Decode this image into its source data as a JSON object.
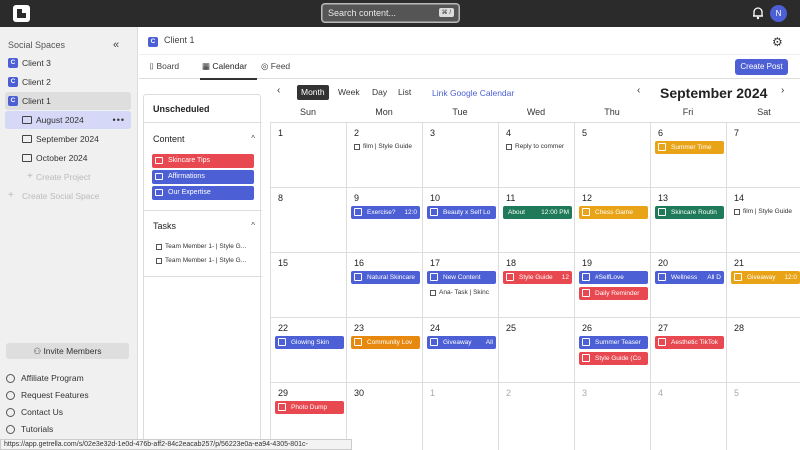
{
  "topbar": {
    "search_placeholder": "Search content...",
    "search_kbd": "⌘ /",
    "avatar": "N"
  },
  "sidebar": {
    "title": "Social Spaces",
    "clients": [
      {
        "badge": "C",
        "label": "Client 3"
      },
      {
        "badge": "C",
        "label": "Client 2"
      },
      {
        "badge": "C",
        "label": "Client 1"
      }
    ],
    "projects": [
      {
        "label": "August 2024"
      },
      {
        "label": "September 2024"
      },
      {
        "label": "October 2024"
      }
    ],
    "create_project": "Create Project",
    "create_space": "Create Social Space",
    "invite": "Invite Members",
    "footer": [
      "Affiliate Program",
      "Request Features",
      "Contact Us",
      "Tutorials"
    ],
    "status_url": "https://app.getrella.com/s/02e3e32d-1e0d-476b-aff2-84c2eacab257/p/56223e0a-ea94-4305-801c-f126bf840a70"
  },
  "main": {
    "breadcrumb_badge": "C",
    "breadcrumb": "Client 1",
    "tabs": [
      "Board",
      "Calendar",
      "Feed"
    ],
    "create_post": "Create Post"
  },
  "unscheduled": {
    "title": "Unscheduled",
    "content_title": "Content",
    "content_items": [
      {
        "label": "Skincare Tips",
        "color": "#e8484f"
      },
      {
        "label": "Affirmations",
        "color": "#4c5fd5"
      },
      {
        "label": "Our Expertise",
        "color": "#4c5fd5"
      }
    ],
    "tasks_title": "Tasks",
    "tasks": [
      "Team Member 1- | Style G...",
      "Team Member 1- | Style G..."
    ]
  },
  "calendar": {
    "views": [
      "Month",
      "Week",
      "Day",
      "List"
    ],
    "link_google": "Link Google Calendar",
    "month_title": "September 2024",
    "days": [
      "Sun",
      "Mon",
      "Tue",
      "Wed",
      "Thu",
      "Fri",
      "Sat"
    ],
    "weeks": [
      [
        {
          "d": "1"
        },
        {
          "d": "2",
          "items": [
            {
              "k": "check",
              "t": "film | Style Guide"
            }
          ]
        },
        {
          "d": "3"
        },
        {
          "d": "4",
          "items": [
            {
              "k": "check",
              "t": "Reply to commer"
            }
          ]
        },
        {
          "d": "5"
        },
        {
          "d": "6",
          "items": [
            {
              "k": "ev",
              "t": "Summer Time",
              "c": "#e8a317"
            }
          ]
        },
        {
          "d": "7"
        }
      ],
      [
        {
          "d": "8"
        },
        {
          "d": "9",
          "items": [
            {
              "k": "ev",
              "t": "Exercise?",
              "time": "12:0",
              "c": "#4c5fd5"
            }
          ]
        },
        {
          "d": "10",
          "items": [
            {
              "k": "ev",
              "t": "Beauty x Self Lo",
              "c": "#4c5fd5"
            }
          ]
        },
        {
          "d": "11",
          "items": [
            {
              "k": "txt",
              "t": "About",
              "time": "12:00 PM",
              "c": "#1f7a5a"
            }
          ]
        },
        {
          "d": "12",
          "items": [
            {
              "k": "ev",
              "t": "Chess Game",
              "c": "#e8a317"
            }
          ]
        },
        {
          "d": "13",
          "items": [
            {
              "k": "ev",
              "t": "Skincare Routin",
              "c": "#1f7a5a"
            }
          ]
        },
        {
          "d": "14",
          "items": [
            {
              "k": "check",
              "t": "film | Style Guide"
            }
          ]
        }
      ],
      [
        {
          "d": "15"
        },
        {
          "d": "16",
          "items": [
            {
              "k": "ev",
              "t": "Natural Skincare",
              "c": "#4c5fd5"
            }
          ]
        },
        {
          "d": "17",
          "items": [
            {
              "k": "ev",
              "t": "New Content",
              "c": "#4c5fd5"
            },
            {
              "k": "check",
              "t": "Ana- Task | Skinc"
            }
          ]
        },
        {
          "d": "18",
          "items": [
            {
              "k": "ev",
              "t": "Style Guide",
              "time": "12",
              "c": "#e8484f"
            }
          ]
        },
        {
          "d": "19",
          "items": [
            {
              "k": "ev",
              "t": "#SelfLove",
              "c": "#4c5fd5"
            },
            {
              "k": "ev",
              "t": "Daily Reminder",
              "c": "#e8484f"
            }
          ]
        },
        {
          "d": "20",
          "items": [
            {
              "k": "ev",
              "t": "Wellness",
              "time": "All D",
              "c": "#4c5fd5"
            }
          ]
        },
        {
          "d": "21",
          "items": [
            {
              "k": "ev",
              "t": "Giveaway",
              "time": "12:0",
              "c": "#e8a317"
            }
          ]
        }
      ],
      [
        {
          "d": "22",
          "items": [
            {
              "k": "ev",
              "t": "Glowing Skin",
              "c": "#4c5fd5"
            }
          ]
        },
        {
          "d": "23",
          "items": [
            {
              "k": "ev",
              "t": "Community Lov",
              "c": "#e8890f"
            }
          ]
        },
        {
          "d": "24",
          "items": [
            {
              "k": "ev",
              "t": "Giveaway",
              "time": "All",
              "c": "#4c5fd5"
            }
          ]
        },
        {
          "d": "25"
        },
        {
          "d": "26",
          "items": [
            {
              "k": "ev",
              "t": "Summer Teaser",
              "c": "#4c5fd5"
            },
            {
              "k": "ev",
              "t": "Style Guide (Co",
              "c": "#e8484f"
            }
          ]
        },
        {
          "d": "27",
          "items": [
            {
              "k": "ev",
              "t": "Aesthetic TikTok",
              "c": "#e8484f"
            }
          ]
        },
        {
          "d": "28"
        }
      ],
      [
        {
          "d": "29",
          "items": [
            {
              "k": "ev",
              "t": "Photo Dump",
              "c": "#e8484f"
            }
          ]
        },
        {
          "d": "30"
        },
        {
          "d": "1",
          "m": true
        },
        {
          "d": "2",
          "m": true
        },
        {
          "d": "3",
          "m": true
        },
        {
          "d": "4",
          "m": true
        },
        {
          "d": "5",
          "m": true
        }
      ]
    ]
  }
}
